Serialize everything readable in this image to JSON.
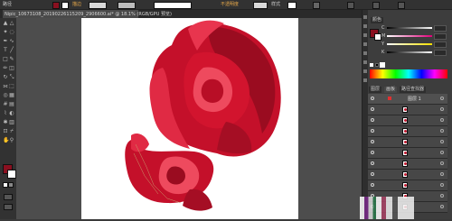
{
  "app": {
    "name": "Adobe Illustrator"
  },
  "control_bar": {
    "selection_label": "路径",
    "brush_label": "描边",
    "opacity_label": "不透明度",
    "style_label": "样式"
  },
  "document_tab": {
    "title": "Nipic_10673108_20190226115209_2906600.ai* @ 18.1% (RGB/GPU 预览)"
  },
  "color_panel": {
    "tab_label": "颜色",
    "channels": [
      "C",
      "M",
      "Y",
      "K"
    ],
    "fill_color": "#8a1020",
    "stroke_color": "#ffffff"
  },
  "layers_panel": {
    "tabs": [
      "图层",
      "画板",
      "路径查找器"
    ],
    "top_layer_name": "图层 1",
    "row_count": 12
  },
  "colors": {
    "rose_main": "#d2142e",
    "rose_dark": "#9a0c20",
    "rose_light": "#ee4a5e",
    "ui_bg": "#3a3a3a"
  }
}
